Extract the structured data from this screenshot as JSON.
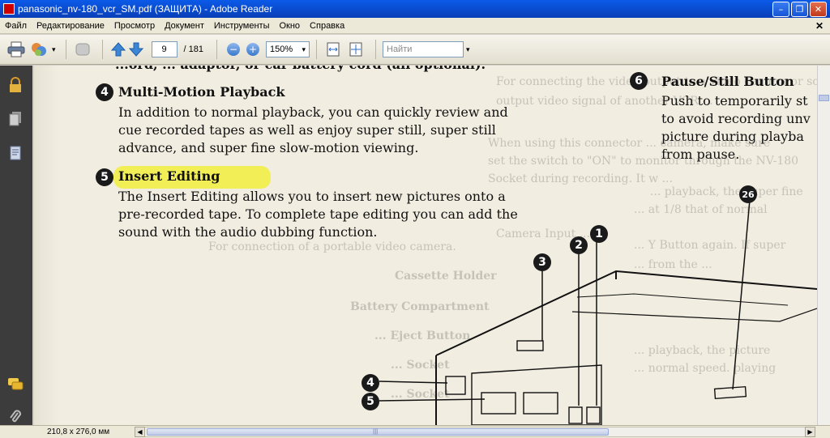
{
  "window": {
    "title": "panasonic_nv-180_vcr_SM.pdf (ЗАЩИТА) - Adobe Reader",
    "minimize": "–",
    "maximize": "❐",
    "close": "✕"
  },
  "menubar": {
    "items": [
      "Файл",
      "Редактирование",
      "Просмотр",
      "Документ",
      "Инструменты",
      "Окно",
      "Справка"
    ],
    "doc_close": "✕"
  },
  "toolbar": {
    "page_current": "9",
    "page_total": "/ 181",
    "zoom": "150%",
    "search_placeholder": "Найти",
    "zoom_out": "−",
    "zoom_in": "+",
    "dropdown_arrow": "▾",
    "icons": [
      "print-icon",
      "share-icon",
      "hand-icon",
      "previous-page-icon",
      "next-page-icon",
      "fit-width-icon",
      "fit-page-icon"
    ]
  },
  "left_panel": {
    "icons": [
      "lock-icon",
      "pages-icon",
      "attachments-icon",
      "comments-icon",
      "paperclip-icon"
    ]
  },
  "document": {
    "top_cut_line": "...ord, ... adaptor, or car battery cord (all optional).",
    "section4": {
      "number": "4",
      "heading": "Multi-Motion Playback",
      "body": [
        "In addition to normal playback, you can quickly review and",
        "cue recorded tapes as well as enjoy super still, super still",
        "advance, and super fine slow-motion viewing."
      ]
    },
    "section5": {
      "number": "5",
      "heading": "Insert Editing",
      "body": [
        "The Insert Editing allows you to insert new pictures onto a",
        "pre-recorded tape.   To complete tape editing you can add the",
        "sound with the audio dubbing function."
      ]
    },
    "section6": {
      "number": "6",
      "heading": "Pause/Still Button",
      "body": [
        "Push to temporarily st",
        "to avoid recording unv",
        "picture during playba",
        "from pause."
      ]
    },
    "ghost_lines": [
      "For connecting the video output to a video camera or so",
      "output video signal of another VCR ...",
      "When using this connector ... camera, make sure",
      "set the switch to \"ON\" to monitor through the NV-180",
      "Socket during recording.  It w ...",
      "Camera Input ...",
      "For connection of a portable video camera.",
      "Cassette Holder",
      "Battery Compartment",
      "... Eject Button",
      "... Socket",
      "... Socket"
    ],
    "ghost_right": [
      "... playback, the super fine",
      "... at 1/8 that of normal",
      "... Y Button again.  If super",
      "... from the ...",
      "... playback, the picture",
      "... normal speed.  playing"
    ],
    "callouts": [
      "1",
      "2",
      "3",
      "4",
      "5",
      "26"
    ]
  },
  "statusbar": {
    "page_size": "210,8 x 276,0 мм",
    "left_arrow": "◀",
    "right_arrow": "▶",
    "grip": "|||"
  }
}
